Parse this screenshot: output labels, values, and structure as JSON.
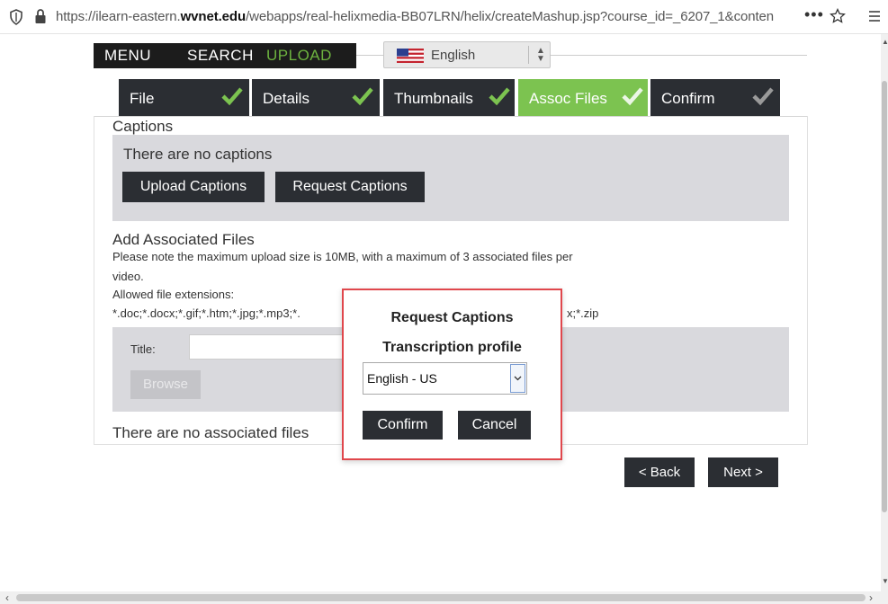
{
  "browser": {
    "url_prefix": "https://ilearn-eastern.",
    "url_domain": "wvnet.edu",
    "url_rest": "/webapps/real-helixmedia-BB07LRN/helix/createMashup.jsp?course_id=_6207_1&conten",
    "overflow": "•••"
  },
  "nav": {
    "menu": "MENU",
    "search": "SEARCH",
    "upload": "UPLOAD",
    "language": "English"
  },
  "tabs": [
    {
      "label": "File",
      "state": "done"
    },
    {
      "label": "Details",
      "state": "done"
    },
    {
      "label": "Thumbnails",
      "state": "done"
    },
    {
      "label": "Assoc Files",
      "state": "active"
    },
    {
      "label": "Confirm",
      "state": "pending"
    }
  ],
  "captions": {
    "title": "Captions",
    "empty": "There are no captions",
    "upload_btn": "Upload Captions",
    "request_btn": "Request Captions"
  },
  "assoc": {
    "title": "Add Associated Files",
    "note_line1": "Please note the maximum upload size is 10MB, with a maximum of 3 associated files per",
    "note_line2": "video.",
    "ext_label": "Allowed file extensions:",
    "ext_list_left": "*.doc;*.docx;*.gif;*.htm;*.jpg;*.mp3;*.",
    "ext_list_right": "x;*.zip",
    "title_label": "Title:",
    "browse": "Browse",
    "empty": "There are no associated files"
  },
  "footer": {
    "back": "< Back",
    "next": "Next >"
  },
  "modal": {
    "title": "Request Captions",
    "subtitle": "Transcription profile",
    "selected": "English - US",
    "confirm": "Confirm",
    "cancel": "Cancel",
    "border_color": "#e0474c"
  },
  "colors": {
    "dark": "#2b2e33",
    "accent_green": "#7cc350",
    "panel_gray": "#d9d9dd"
  }
}
